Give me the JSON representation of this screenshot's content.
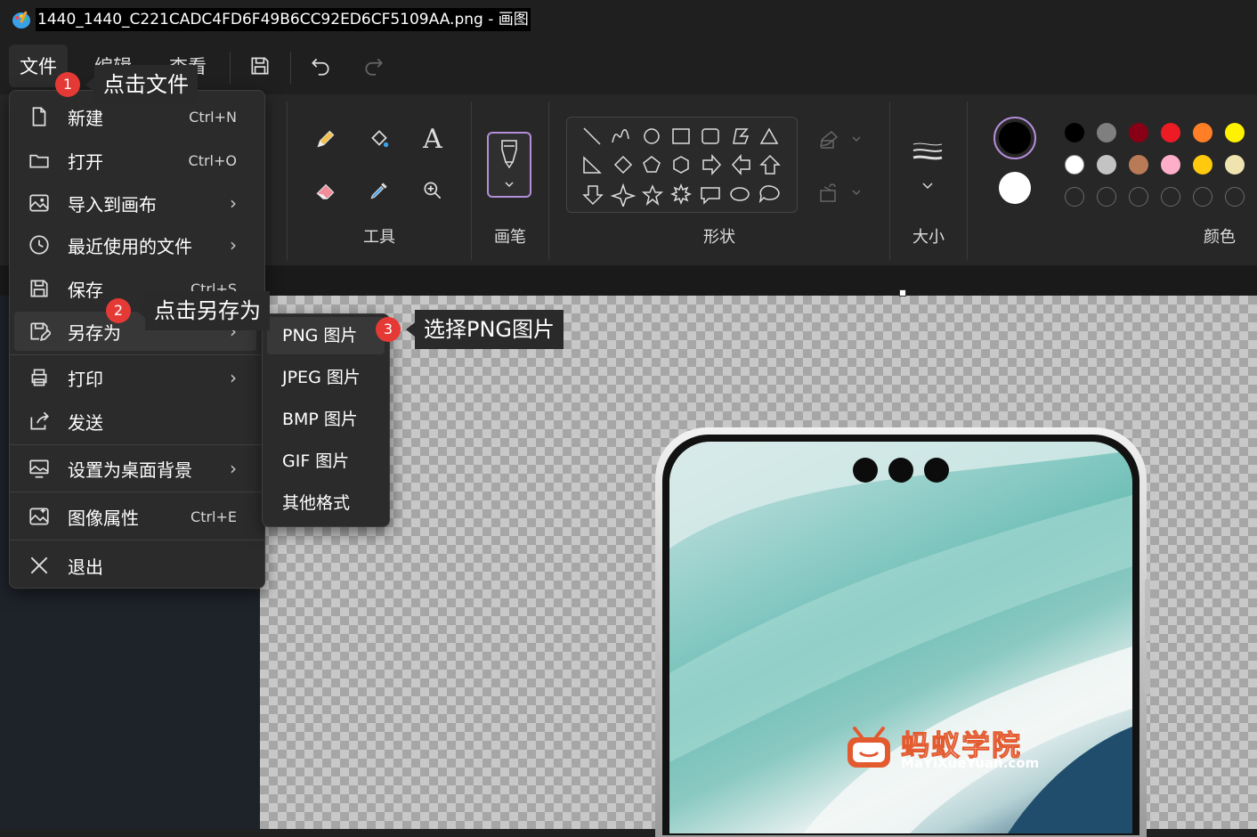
{
  "window": {
    "title": "1440_1440_C221CADC4FD6F49B6CC92ED6CF5109AA.png - 画图",
    "app_icon": "paint-palette-icon"
  },
  "menubar": {
    "file": "文件",
    "edit": "编辑",
    "view": "查看",
    "icons": [
      "save-icon",
      "undo-icon",
      "redo-icon"
    ]
  },
  "ribbon": {
    "tools_label": "工具",
    "brushes_label": "画笔",
    "shapes_label": "形状",
    "size_label": "大小",
    "colors_label": "颜色",
    "accent_color": "#b48ed8",
    "palette_row1": [
      "#000000",
      "#7f7f7f",
      "#880015",
      "#ed1c24",
      "#ff7f27",
      "#fff200"
    ],
    "palette_row2": [
      "#ffffff",
      "#c3c3c3",
      "#b97a57",
      "#ffaec9",
      "#ffc90e",
      "#efe4b0"
    ]
  },
  "file_menu": {
    "items": [
      {
        "label": "新建",
        "shortcut": "Ctrl+N",
        "icon": "new-file-icon"
      },
      {
        "label": "打开",
        "shortcut": "Ctrl+O",
        "icon": "open-folder-icon"
      },
      {
        "label": "导入到画布",
        "icon": "import-image-icon",
        "submenu": true
      },
      {
        "label": "最近使用的文件",
        "icon": "clock-icon",
        "submenu": true
      },
      {
        "label": "保存",
        "shortcut": "Ctrl+S",
        "icon": "save-icon"
      },
      {
        "label": "另存为",
        "icon": "save-as-icon",
        "submenu": true
      },
      {
        "label": "打印",
        "icon": "printer-icon",
        "submenu": true
      },
      {
        "label": "发送",
        "icon": "share-icon"
      },
      {
        "label": "设置为桌面背景",
        "icon": "desktop-background-icon",
        "submenu": true
      },
      {
        "label": "图像属性",
        "shortcut": "Ctrl+E",
        "icon": "image-properties-icon"
      },
      {
        "label": "退出",
        "icon": "close-icon"
      }
    ],
    "chevron": "›"
  },
  "save_as_submenu": {
    "items": [
      "PNG 图片",
      "JPEG 图片",
      "BMP 图片",
      "GIF 图片",
      "其他格式"
    ]
  },
  "annotations": [
    {
      "number": "1",
      "text": "点击文件"
    },
    {
      "number": "2",
      "text": "点击另存为"
    },
    {
      "number": "3",
      "text": "选择PNG图片"
    }
  ],
  "watermark": {
    "title": "蚂蚁学院",
    "subtitle": "MaYiXueYuan.com",
    "color": "#e35a2f"
  }
}
